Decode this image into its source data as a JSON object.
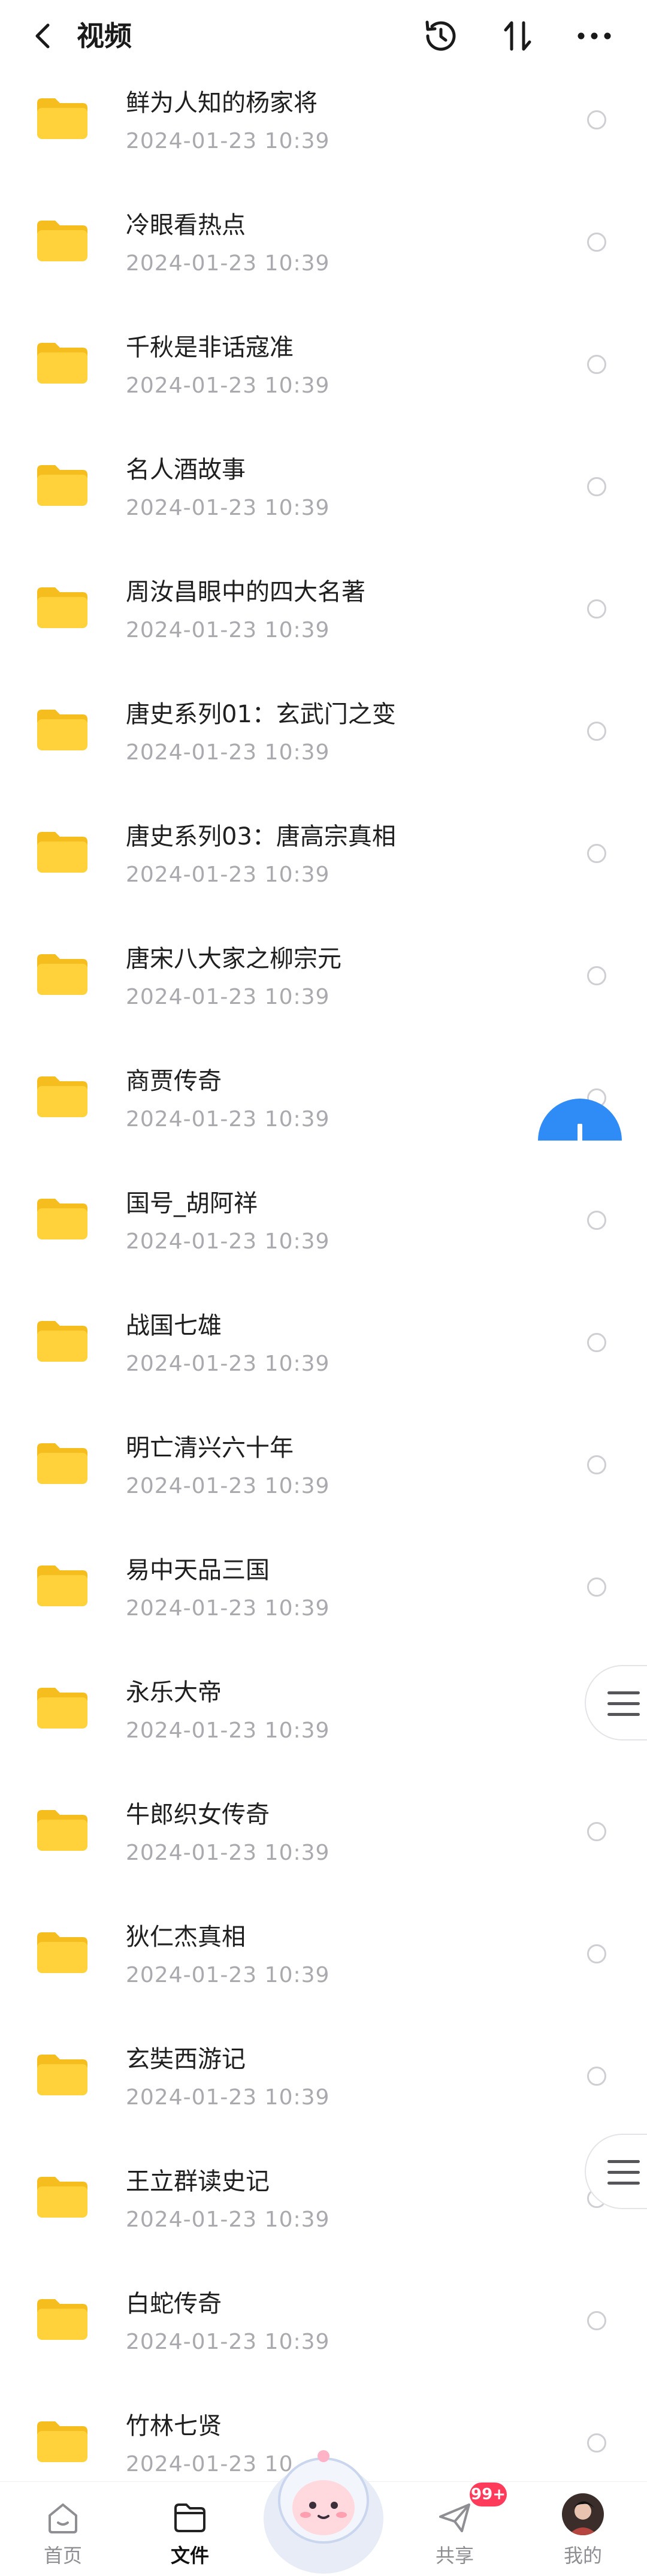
{
  "header": {
    "title": "视频",
    "icons": [
      "back-arrow-icon",
      "history-icon",
      "sort-icon",
      "more-icon"
    ]
  },
  "files": [
    {
      "name": "鲜为人知的杨家将",
      "date": "2024-01-23  10:39"
    },
    {
      "name": "冷眼看热点",
      "date": "2024-01-23  10:39"
    },
    {
      "name": "千秋是非话寇准",
      "date": "2024-01-23  10:39"
    },
    {
      "name": "名人酒故事",
      "date": "2024-01-23  10:39"
    },
    {
      "name": "周汝昌眼中的四大名著",
      "date": "2024-01-23  10:39"
    },
    {
      "name": "唐史系列01：玄武门之变",
      "date": "2024-01-23  10:39"
    },
    {
      "name": "唐史系列03：唐高宗真相",
      "date": "2024-01-23  10:39"
    },
    {
      "name": "唐宋八大家之柳宗元",
      "date": "2024-01-23  10:39"
    },
    {
      "name": "商贾传奇",
      "date": "2024-01-23  10:39"
    },
    {
      "name": "国号_胡阿祥",
      "date": "2024-01-23  10:39"
    },
    {
      "name": "战国七雄",
      "date": "2024-01-23  10:39"
    },
    {
      "name": "明亡清兴六十年",
      "date": "2024-01-23  10:39"
    },
    {
      "name": "易中天品三国",
      "date": "2024-01-23  10:39"
    },
    {
      "name": "永乐大帝",
      "date": "2024-01-23  10:39"
    },
    {
      "name": "牛郎织女传奇",
      "date": "2024-01-23  10:39"
    },
    {
      "name": "狄仁杰真相",
      "date": "2024-01-23  10:39"
    },
    {
      "name": "玄奘西游记",
      "date": "2024-01-23  10:39"
    },
    {
      "name": "王立群读史记",
      "date": "2024-01-23  10:39"
    },
    {
      "name": "白蛇传奇",
      "date": "2024-01-23  10:39"
    },
    {
      "name": "竹林七贤",
      "date": "2024-01-23  10"
    }
  ],
  "tabbar": {
    "home": "首页",
    "files": "文件",
    "share": "共享",
    "mine": "我的",
    "share_badge": "99+"
  },
  "colors": {
    "folder": "#FFD23C",
    "folder_tab": "#F5BE1E",
    "fab": "#2F8CF7",
    "badge": "#FF3B5C"
  }
}
